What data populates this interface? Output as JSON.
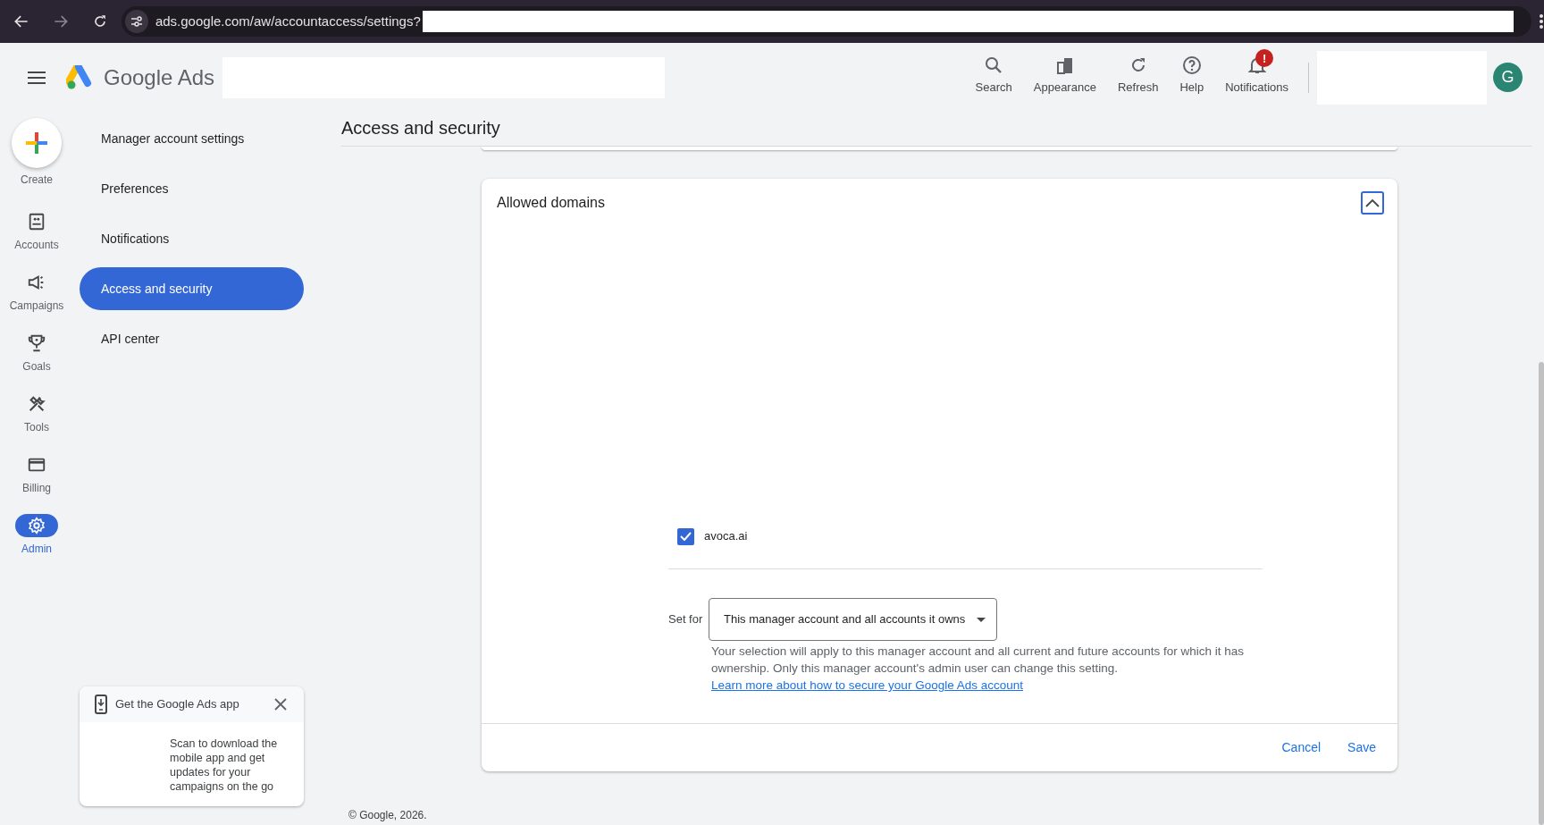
{
  "browser": {
    "url": "ads.google.com/aw/accountaccess/settings?"
  },
  "header": {
    "product": "Google Ads",
    "actions": [
      {
        "label": "Search",
        "kind": "search"
      },
      {
        "label": "Appearance",
        "kind": "appearance"
      },
      {
        "label": "Refresh",
        "kind": "refresh"
      },
      {
        "label": "Help",
        "kind": "help"
      },
      {
        "label": "Notifications",
        "kind": "bell",
        "badge": "!"
      }
    ],
    "avatar": "G"
  },
  "rail": [
    {
      "label": "Create",
      "kind": "create"
    },
    {
      "label": "Accounts",
      "kind": "accounts",
      "selected": false
    },
    {
      "label": "Campaigns",
      "kind": "campaigns",
      "selected": false
    },
    {
      "label": "Goals",
      "kind": "goals",
      "selected": false
    },
    {
      "label": "Tools",
      "kind": "tools",
      "selected": false
    },
    {
      "label": "Billing",
      "kind": "billing",
      "selected": false
    },
    {
      "label": "Admin",
      "kind": "admin",
      "selected": true
    }
  ],
  "settings_nav": [
    {
      "label": "Manager account settings",
      "selected": false
    },
    {
      "label": "Preferences",
      "selected": false
    },
    {
      "label": "Notifications",
      "selected": false
    },
    {
      "label": "Access and security",
      "selected": true
    },
    {
      "label": "API center",
      "selected": false
    }
  ],
  "page_title": "Access and security",
  "card": {
    "title": "Allowed domains",
    "expanded": true,
    "domains": [
      {
        "label": "avoca.ai",
        "checked": true
      }
    ],
    "set_for": {
      "label": "Set for",
      "value": "This manager account and all accounts it owns"
    },
    "help": "Your selection will apply to this manager account and all current and future accounts for which it has ownership. Only this manager account's admin user can change this setting.",
    "help_link": "Learn more about how to secure your Google Ads account",
    "buttons": [
      "Cancel",
      "Save"
    ]
  },
  "app_promo": {
    "title": "Get the Google Ads app",
    "text": "Scan to download the mobile app and get updates for your campaigns on the go"
  },
  "footer": "© Google, 2026."
}
